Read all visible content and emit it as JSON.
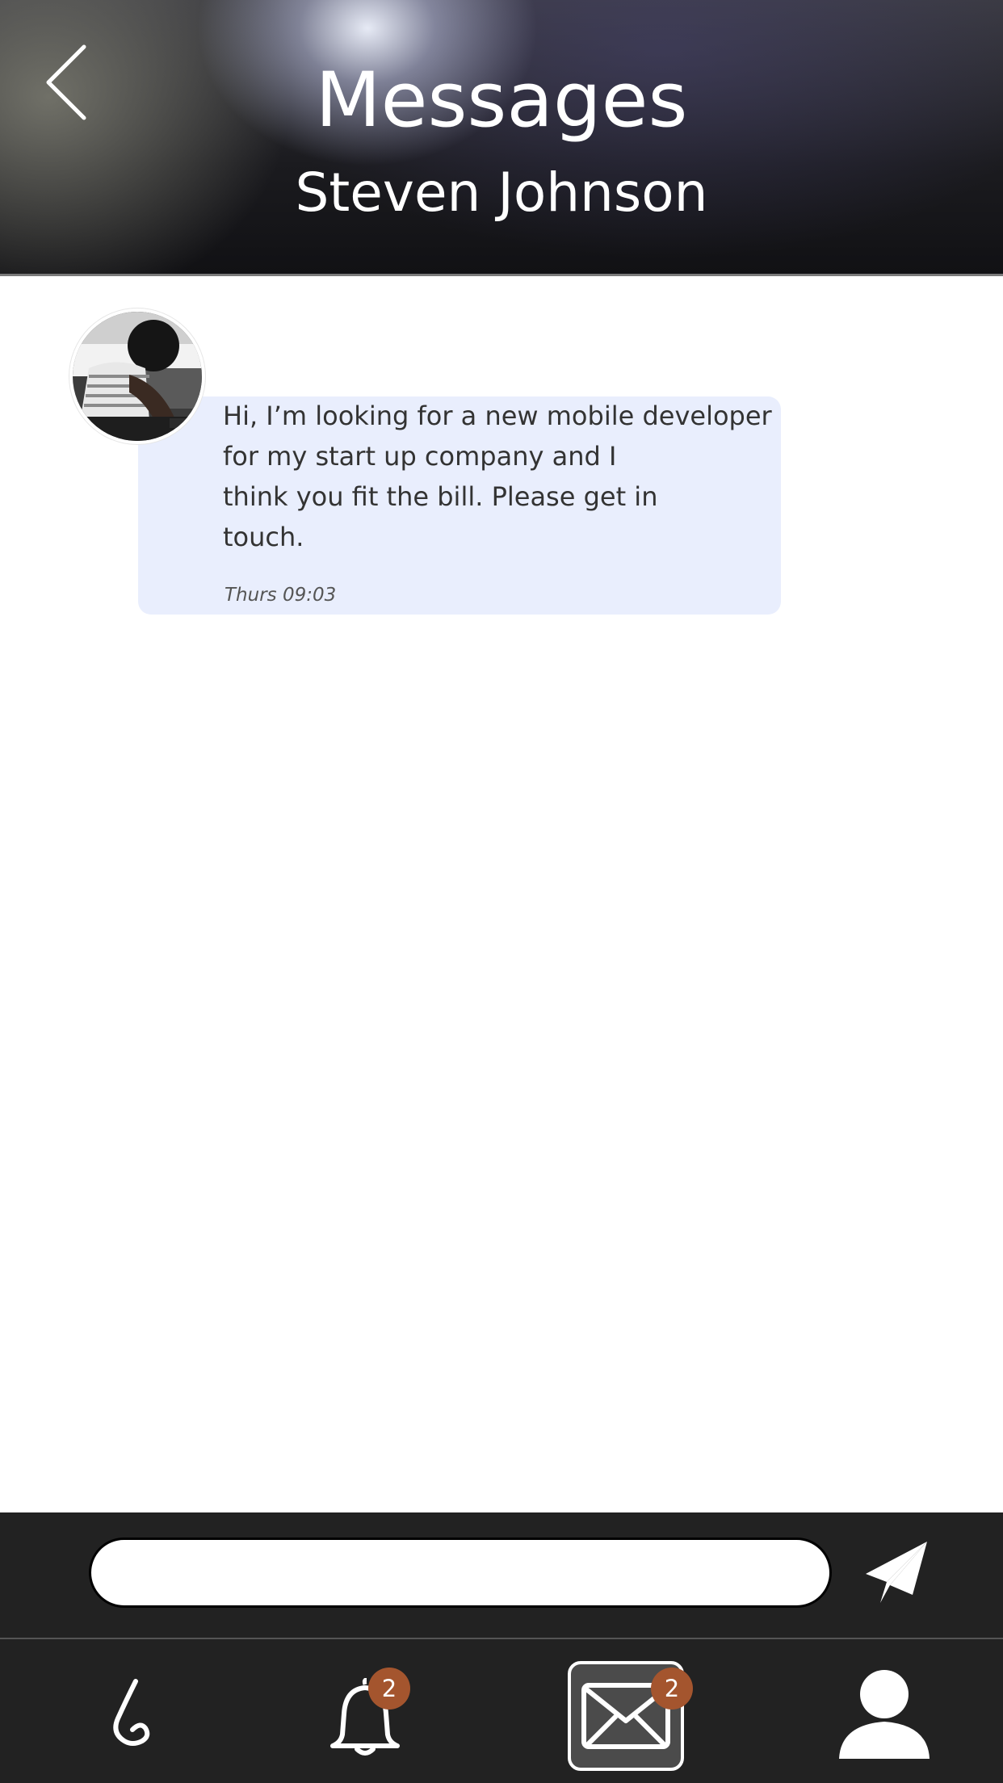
{
  "header": {
    "title": "Messages",
    "subtitle": "Steven Johnson"
  },
  "conversation": {
    "messages": [
      {
        "text": "Hi, I’m looking for a new mobile developer for my start up company and I think you fit the bill. Please get in touch.",
        "lines": [
          "Hi, I’m looking for a new mobile developer",
          "for my start up company and I",
          "think you fit the bill. Please get in",
          "touch."
        ],
        "time": "Thurs 09:03"
      }
    ]
  },
  "composer": {
    "input_value": "",
    "send_icon": "paper-plane-icon"
  },
  "nav": {
    "items": [
      {
        "icon": "nose-icon"
      },
      {
        "icon": "bell-icon",
        "badge": "2"
      },
      {
        "icon": "envelope-icon",
        "badge": "2",
        "active": true
      },
      {
        "icon": "user-icon"
      }
    ]
  },
  "colors": {
    "bubble": "#e9eefd",
    "bar": "#222222",
    "badge": "#a4552e"
  }
}
